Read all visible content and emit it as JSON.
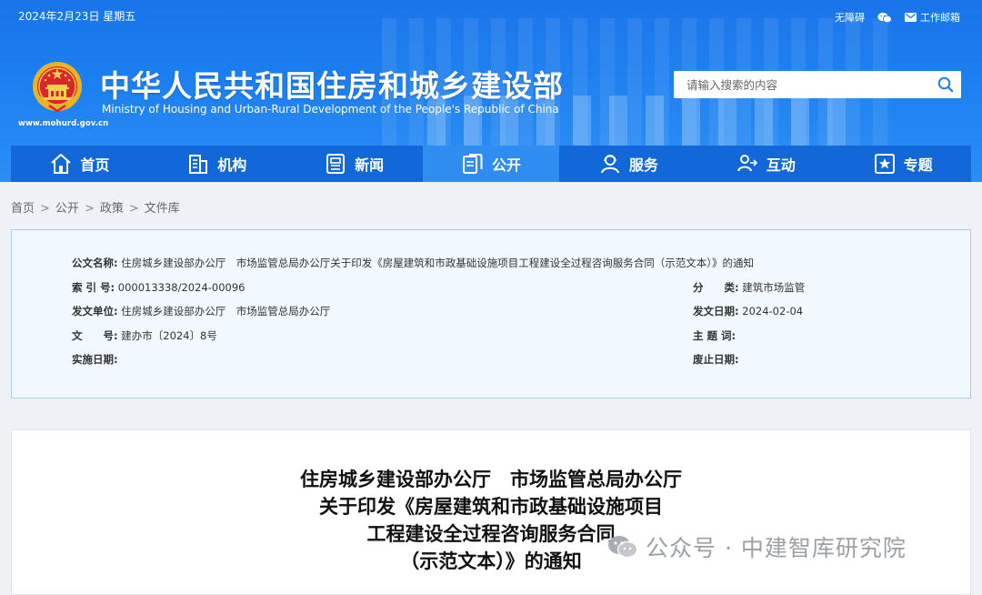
{
  "header": {
    "date": "2024年2月23日 星期五",
    "links": {
      "accessibility": "无障碍",
      "wechat_icon": "wechat-icon",
      "mail": "工作邮箱"
    },
    "title_cn": "中华人民共和国住房和城乡建设部",
    "title_en": "Ministry of Housing and Urban-Rural Development of the People's Republic of China",
    "url": "www.mohurd.gov.cn",
    "search": {
      "placeholder": "请输入搜索的内容",
      "value": ""
    }
  },
  "nav": [
    {
      "label": "首页",
      "icon": "home-icon"
    },
    {
      "label": "机构",
      "icon": "building-icon"
    },
    {
      "label": "新闻",
      "icon": "news-icon"
    },
    {
      "label": "公开",
      "icon": "document-icon",
      "active": true
    },
    {
      "label": "服务",
      "icon": "service-icon"
    },
    {
      "label": "互动",
      "icon": "interaction-icon"
    },
    {
      "label": "专题",
      "icon": "topic-icon"
    }
  ],
  "breadcrumb": [
    "首页",
    "公开",
    "政策",
    "文件库"
  ],
  "info": {
    "name_label": "公文名称:",
    "name_value": "住房城乡建设部办公厅　市场监管总局办公厅关于印发《房屋建筑和市政基础设施项目工程建设全过程咨询服务合同（示范文本）》的通知",
    "index_label": "索 引 号:",
    "index_value": "000013338/2024-00096",
    "category_label": "分　　类:",
    "category_value": "建筑市场监管",
    "issuer_label": "发文单位:",
    "issuer_value": "住房城乡建设部办公厅　市场监管总局办公厅",
    "date_label": "发文日期:",
    "date_value": "2024-02-04",
    "doc_no_label": "文　　号:",
    "doc_no_value": "建办市〔2024〕8号",
    "keywords_label": "主 题 词:",
    "keywords_value": "",
    "effective_label": "实施日期:",
    "effective_value": "",
    "expiry_label": "废止日期:",
    "expiry_value": ""
  },
  "document": {
    "title_lines": [
      "住房城乡建设部办公厅　市场监管总局办公厅",
      "关于印发《房屋建筑和市政基础设施项目",
      "工程建设全过程咨询服务合同",
      "（示范文本）》的通知"
    ]
  },
  "watermark": {
    "text": "公众号 · 中建智库研究院"
  },
  "colors": {
    "brand_blue": "#1b7ef0",
    "nav_blue": "#1268d8",
    "nav_active": "#2f8df2",
    "info_bg": "#f1f8fe"
  }
}
